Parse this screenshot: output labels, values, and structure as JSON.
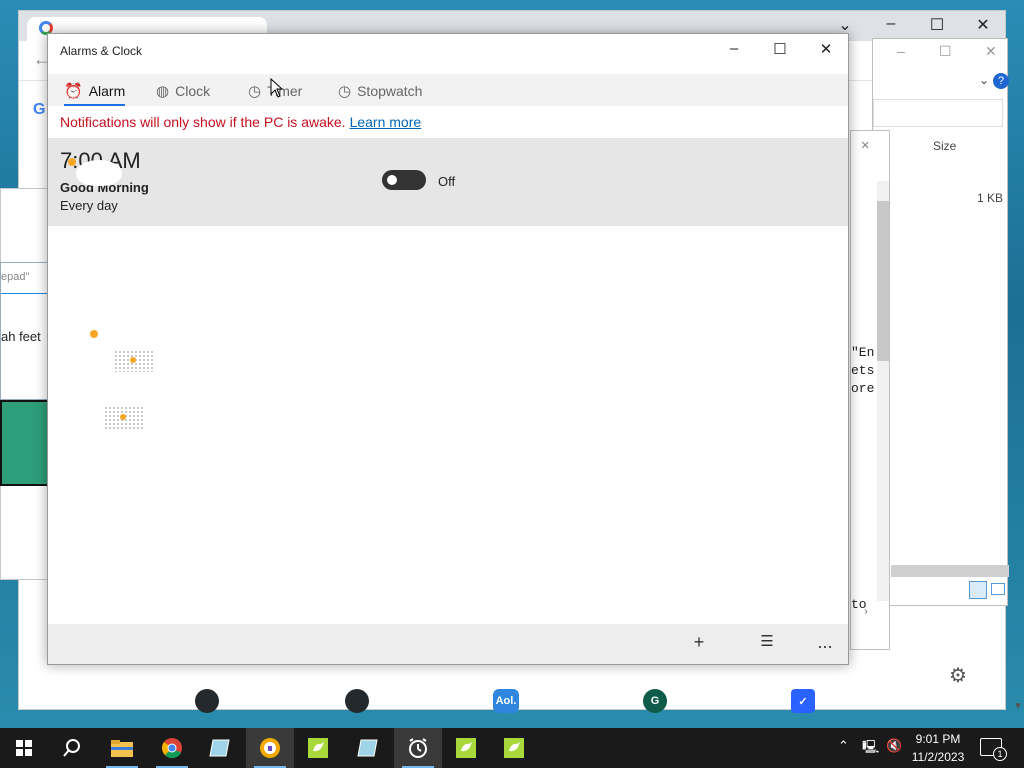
{
  "alarms_app": {
    "title": "Alarms & Clock",
    "tabs": [
      {
        "label": "Alarm",
        "icon": "alarm-icon",
        "active": true
      },
      {
        "label": "Clock",
        "icon": "globe-icon",
        "active": false
      },
      {
        "label": "Timer",
        "icon": "timer-icon",
        "active": false
      },
      {
        "label": "Stopwatch",
        "icon": "stopwatch-icon",
        "active": false
      }
    ],
    "notice": "Notifications will only show if the PC is awake.",
    "notice_link": "Learn more",
    "alarm": {
      "time": "7:00 AM",
      "name": "Good Morning",
      "repeat": "Every day",
      "toggle_state": "Off"
    },
    "bottom_bar": {
      "add": "+",
      "select": "☑",
      "more": "..."
    }
  },
  "explorer": {
    "size_header": "Size",
    "size_value": "1 KB"
  },
  "editor_snippets": [
    "\"En",
    "ets",
    "ore",
    "to"
  ],
  "dialog_back": {
    "title": "epad\"",
    "text": "ah feet"
  },
  "chrome_bottom_icons": [
    {
      "name": "github-icon",
      "label": "",
      "color": "#24292e"
    },
    {
      "name": "github-icon",
      "label": "",
      "color": "#24292e"
    },
    {
      "name": "aol-icon",
      "label": "Aol.",
      "color": "#2e86de"
    },
    {
      "name": "g-icon",
      "label": "G",
      "color": "#0f5c4a"
    },
    {
      "name": "shield-check-icon",
      "label": "",
      "color": "#2962ff"
    }
  ],
  "taskbar": {
    "time": "9:01 PM",
    "date": "11/2/2023",
    "notification_count": "1",
    "items": [
      "windows-start-icon",
      "search-icon",
      "file-explorer-icon",
      "chrome-icon",
      "notepad-icon",
      "vpn-icon",
      "goose-icon",
      "notepad-icon",
      "alarms-clock-icon",
      "goose-icon",
      "goose-icon"
    ]
  },
  "colors": {
    "accent": "#1a73e8",
    "warning_text": "#c50f1f",
    "link": "#0067b8",
    "taskbar": "#1a1a1a"
  }
}
